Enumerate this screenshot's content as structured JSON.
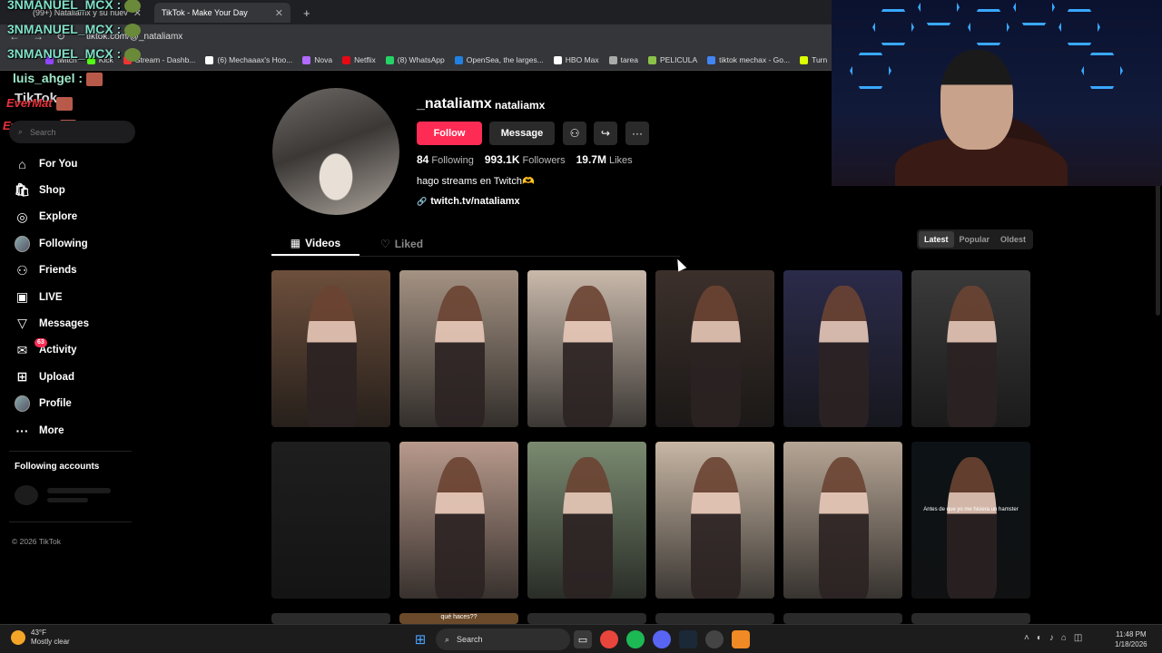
{
  "browser": {
    "tabs": [
      {
        "label": "(99+) Nataliamx y su nuev"
      },
      {
        "label": "TikTok - Make Your Day"
      }
    ],
    "url": "tiktok.com/@_nataliamx",
    "bookmarks": [
      "twitch",
      "Kick",
      "Stream - Dashb...",
      "(6) Mechaaax's Hoo...",
      "Nova",
      "Netflix",
      "(8) WhatsApp",
      "OpenSea, the larges...",
      "HBO Max",
      "tarea",
      "PELICULA",
      "tiktok mechax - Go...",
      "Turn"
    ],
    "bookmark_colors": [
      "#9146ff",
      "#53fc18",
      "#e33",
      "#fff",
      "#b06bff",
      "#e50914",
      "#25d366",
      "#2081e2",
      "#fff",
      "#aaa",
      "#8bc34a",
      "#4285f4",
      "#ddff00"
    ]
  },
  "overlay": {
    "chat1": "3NMANUEL_MCX :",
    "chat2": "3NMANUEL_MCX :",
    "chat3": "3NMANUEL_MCX :",
    "chat4": "luis_ahgel :",
    "chat5": "EverMat",
    "chat6": "EverMat :",
    "tiktok_logo": "TikTok"
  },
  "sidebar": {
    "search_placeholder": "Search",
    "items": [
      {
        "label": "For You",
        "icon": "home-icon"
      },
      {
        "label": "Shop",
        "icon": "shop-icon"
      },
      {
        "label": "Explore",
        "icon": "compass-icon"
      },
      {
        "label": "Following",
        "icon": "avatar-icon"
      },
      {
        "label": "Friends",
        "icon": "friends-icon"
      },
      {
        "label": "LIVE",
        "icon": "live-icon"
      },
      {
        "label": "Messages",
        "icon": "messages-icon"
      },
      {
        "label": "Activity",
        "icon": "activity-icon",
        "badge": "63"
      },
      {
        "label": "Upload",
        "icon": "upload-icon"
      },
      {
        "label": "Profile",
        "icon": "profile-icon"
      },
      {
        "label": "More",
        "icon": "more-icon"
      }
    ],
    "following_accounts": "Following accounts",
    "copyright": "© 2026 TikTok"
  },
  "profile": {
    "username": "_nataliamx",
    "nickname": "nataliamx",
    "follow_label": "Follow",
    "message_label": "Message",
    "stats": {
      "following": "84",
      "following_label": "Following",
      "followers": "993.1K",
      "followers_label": "Followers",
      "likes": "19.7M",
      "likes_label": "Likes"
    },
    "bio": "hago streams en Twitch🫶",
    "link": "twitch.tv/nataliamx"
  },
  "content_tabs": {
    "videos": "Videos",
    "liked": "Liked"
  },
  "sort": {
    "latest": "Latest",
    "popular": "Popular",
    "oldest": "Oldest",
    "selected": "Latest"
  },
  "videos": {
    "row1_colors": [
      "#6d4f3c",
      "#a49283",
      "#c9b9ab",
      "#3c302b",
      "#2b2b4a",
      "#3a3a3a"
    ],
    "row2_colors": [
      "#1e1e1e",
      "#b89a8c",
      "#7a8a70",
      "#c7b6a4",
      "#b6a595",
      "#0c1216"
    ],
    "caption_r2_6": "Antes de que yo me hiciera un hamster",
    "caption_r3_2": "qué haces??"
  },
  "taskbar": {
    "temp": "43°F",
    "weather": "Mostly clear",
    "search_placeholder": "Search",
    "time": "11:48 PM",
    "date": "1/18/2026"
  }
}
